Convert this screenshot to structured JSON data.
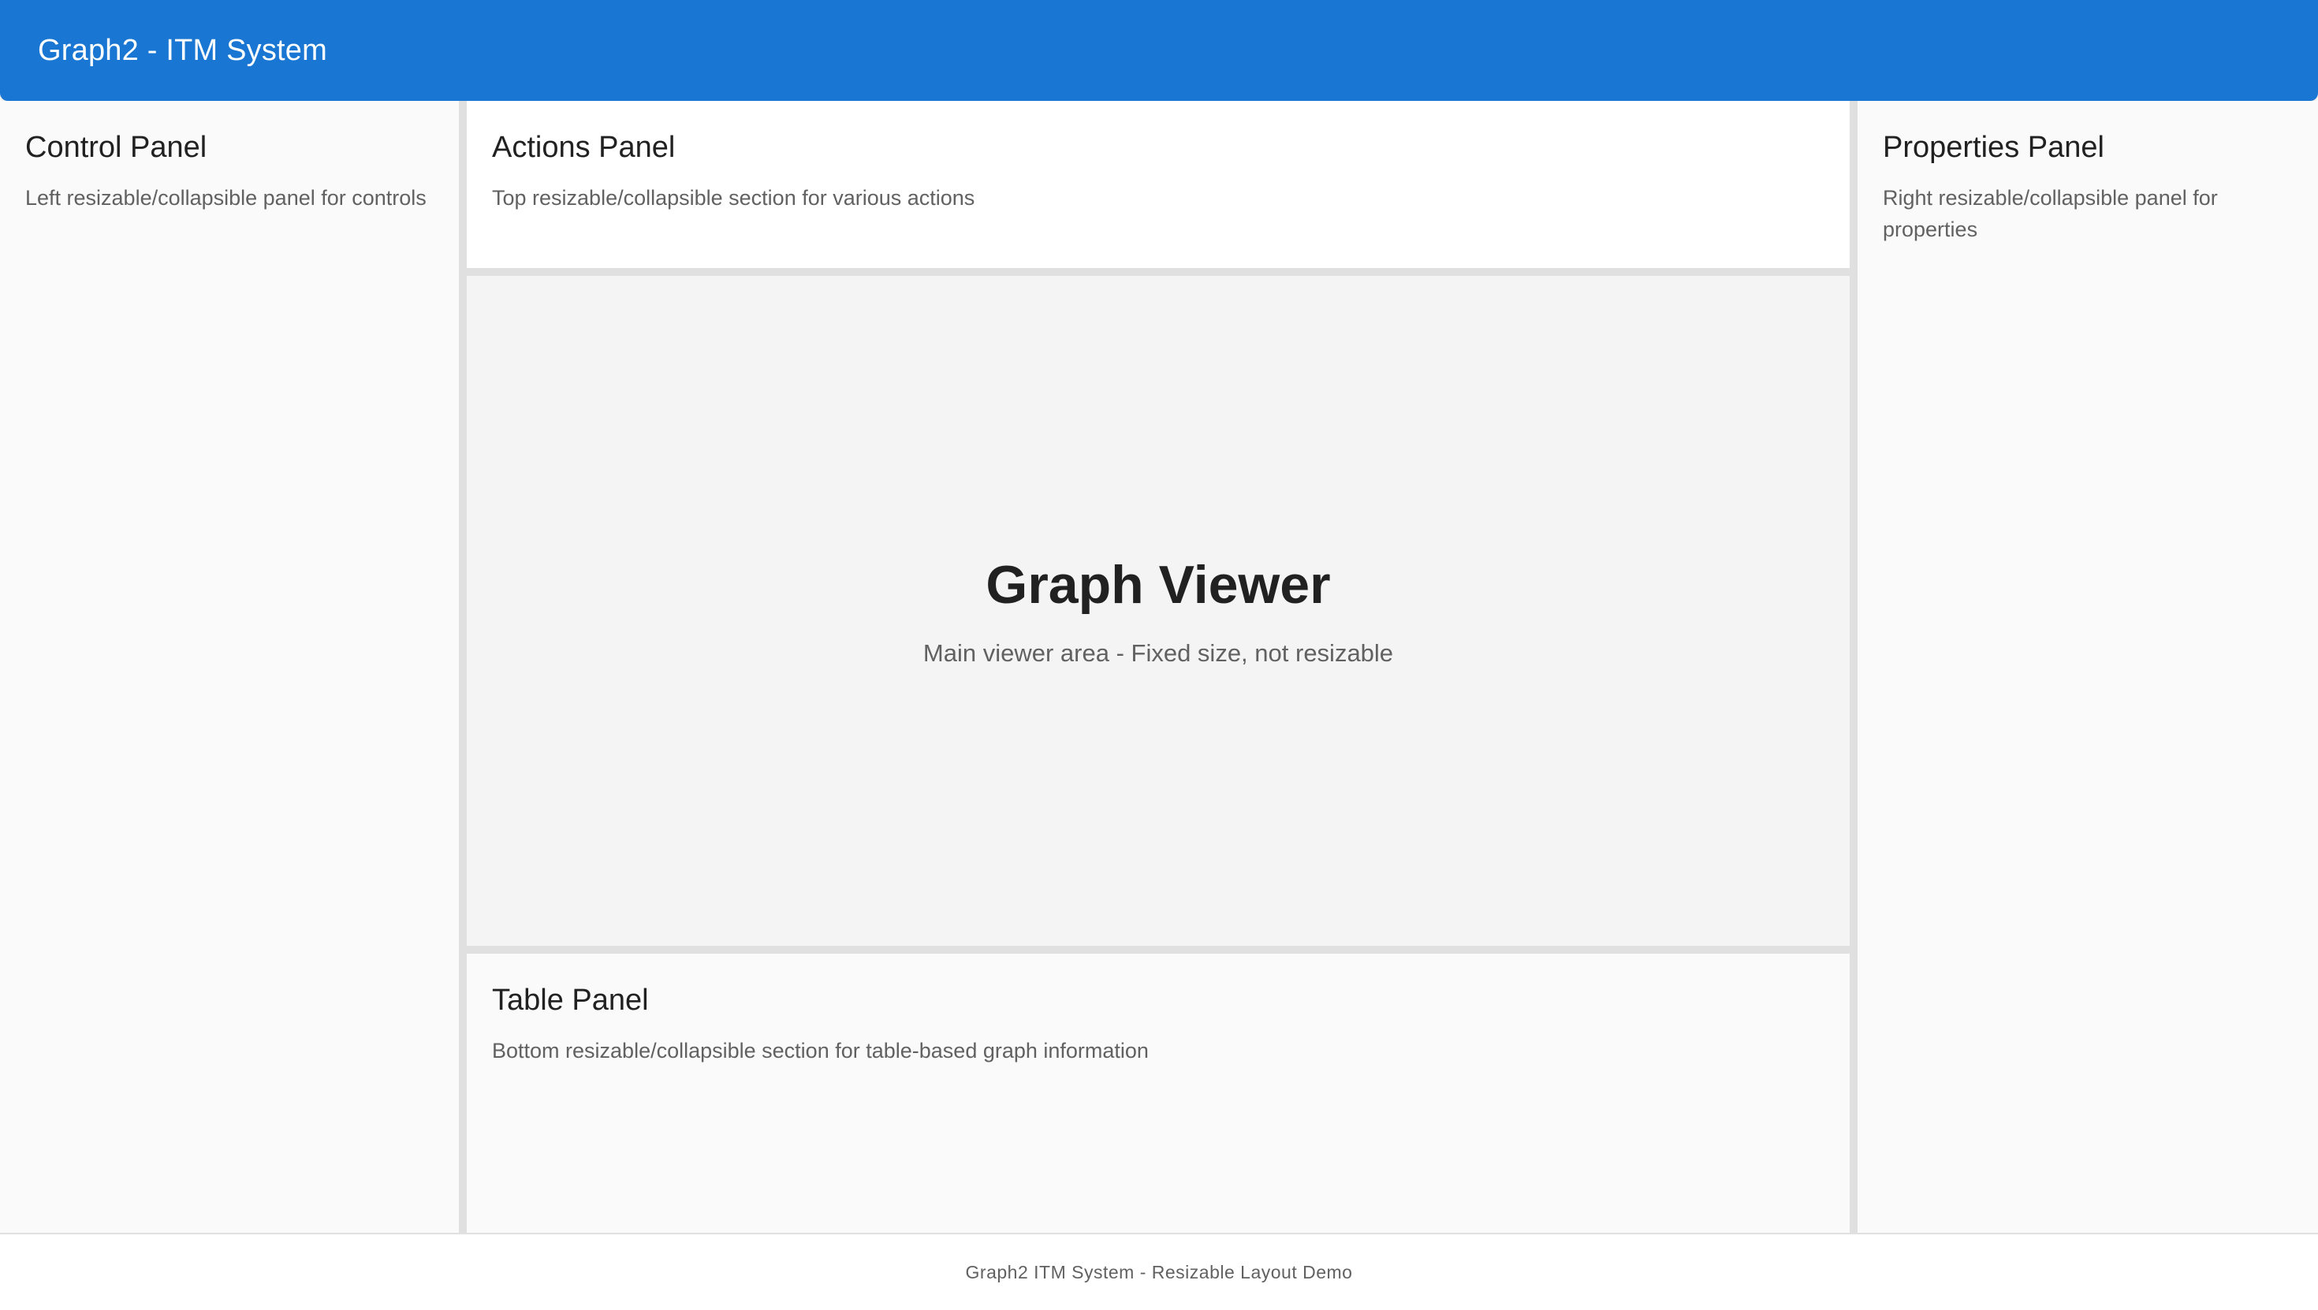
{
  "app": {
    "title": "Graph2 - ITM System"
  },
  "panels": {
    "control": {
      "title": "Control Panel",
      "description": "Left resizable/collapsible panel for controls"
    },
    "actions": {
      "title": "Actions Panel",
      "description": "Top resizable/collapsible section for various actions"
    },
    "viewer": {
      "title": "Graph Viewer",
      "description": "Main viewer area - Fixed size, not resizable"
    },
    "table": {
      "title": "Table Panel",
      "description": "Bottom resizable/collapsible section for table-based graph information"
    },
    "properties": {
      "title": "Properties Panel",
      "description": "Right resizable/collapsible panel for properties"
    }
  },
  "footer": {
    "text": "Graph2 ITM System - Resizable Layout Demo"
  },
  "colors": {
    "app_bar": "#1976d2",
    "panel_bg": "#fafafa",
    "viewer_bg": "#f4f4f4",
    "divider": "#e0e0e0"
  }
}
